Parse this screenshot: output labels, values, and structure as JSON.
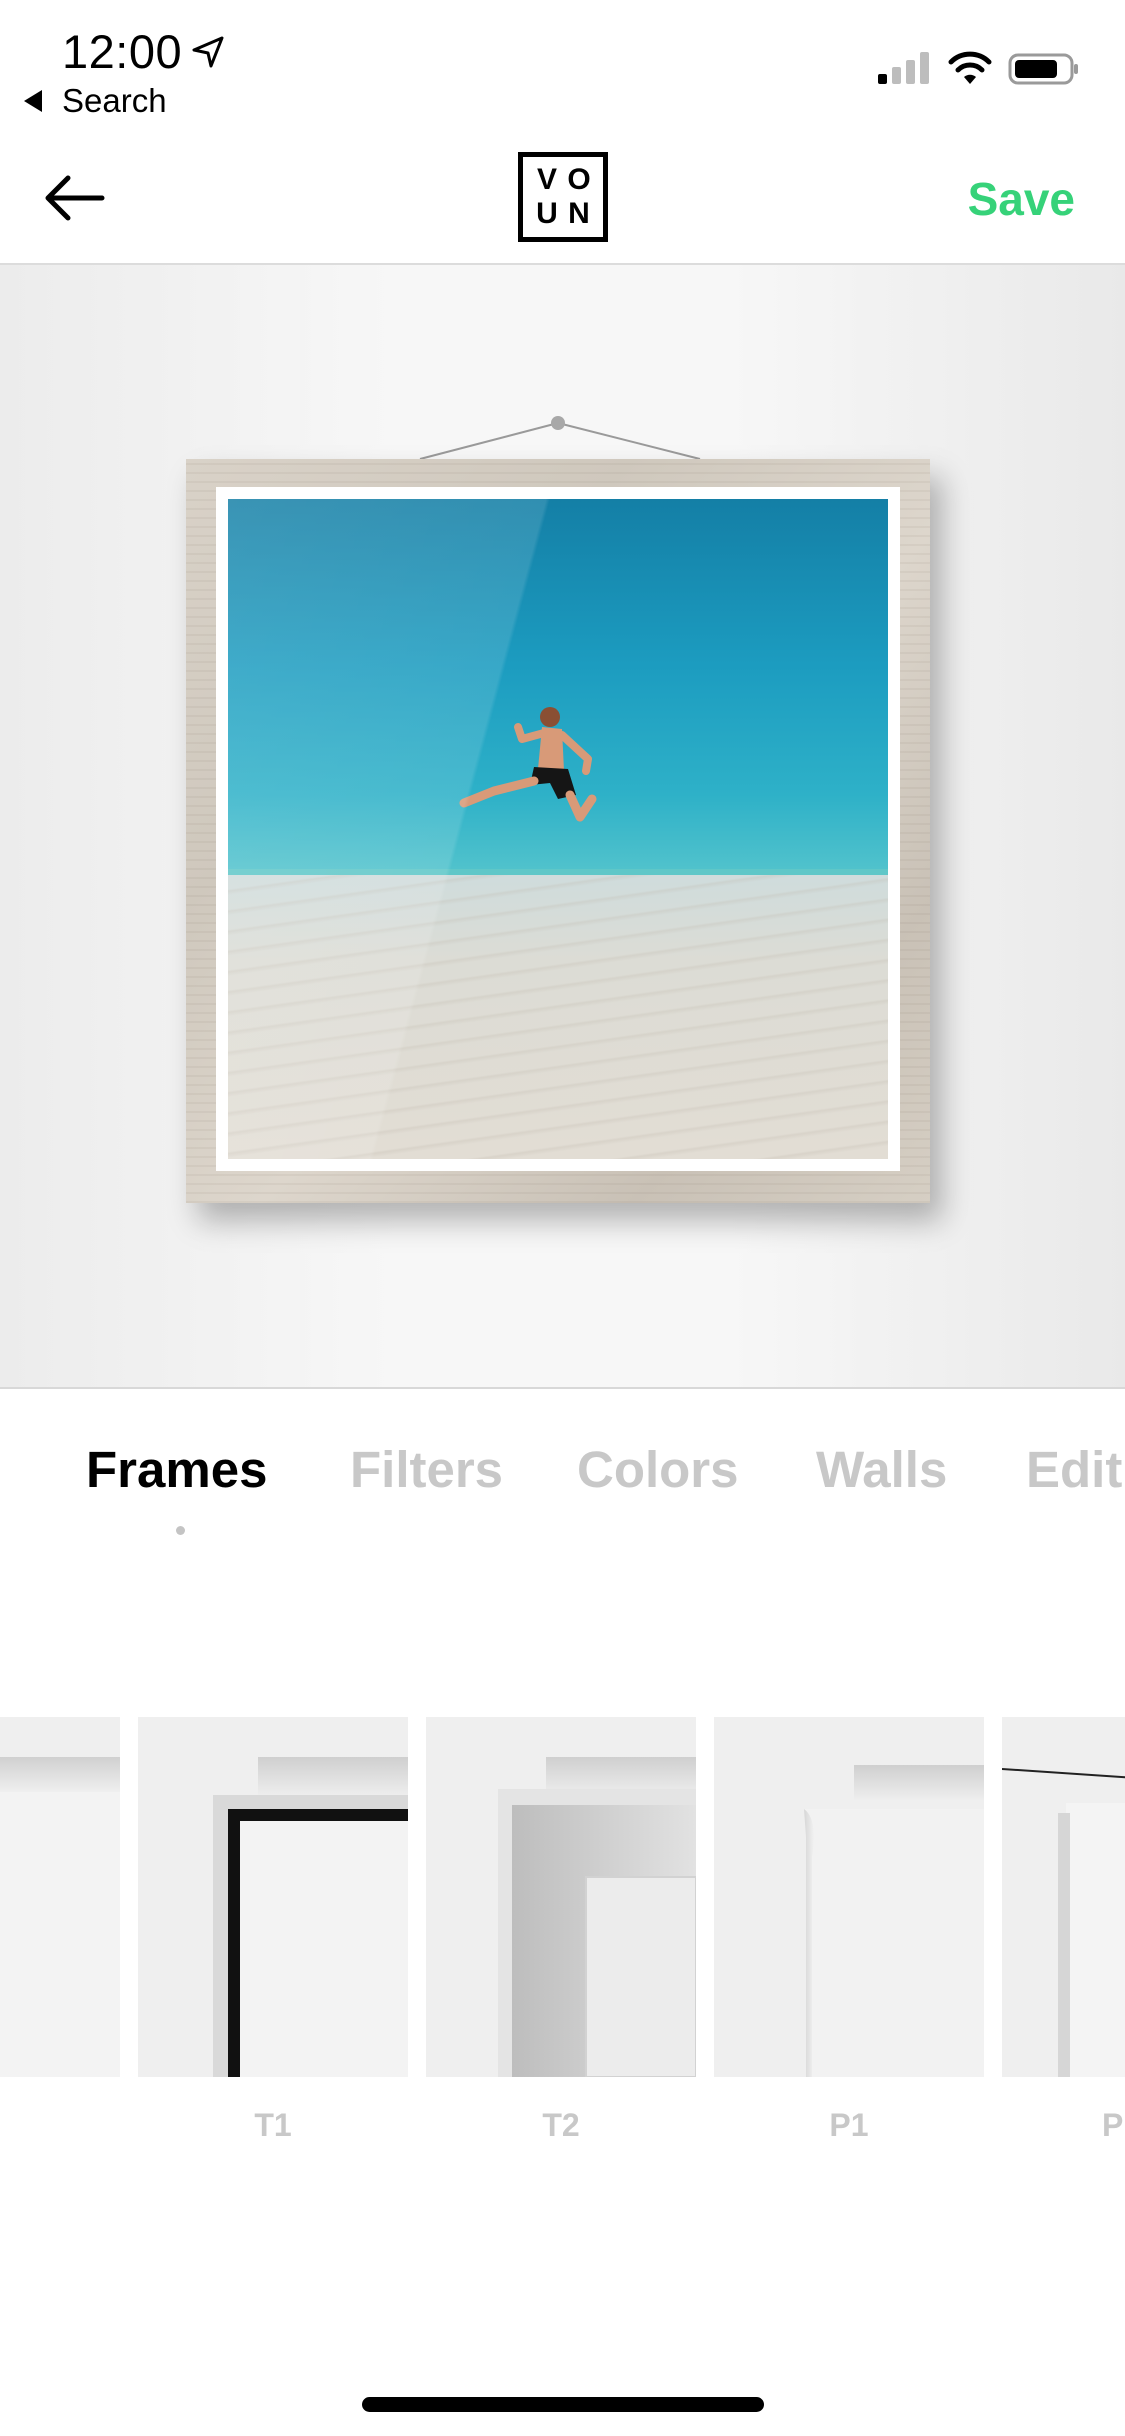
{
  "status_bar": {
    "time": "12:00",
    "back_app_label": "Search"
  },
  "nav": {
    "logo_letters": [
      "V",
      "O",
      "U",
      "N"
    ],
    "save_label": "Save"
  },
  "colors": {
    "accent": "#36d279",
    "tab_active": "#000000",
    "tab_inactive": "#c8c8c8"
  },
  "tabs": [
    {
      "label": "Frames",
      "active": true
    },
    {
      "label": "Filters",
      "active": false
    },
    {
      "label": "Colors",
      "active": false
    },
    {
      "label": "Walls",
      "active": false
    },
    {
      "label": "Edit",
      "active": false
    }
  ],
  "frames": [
    {
      "label": ""
    },
    {
      "label": "T1"
    },
    {
      "label": "T2"
    },
    {
      "label": "P1"
    },
    {
      "label": "P"
    }
  ],
  "icons": {
    "back": "arrow-left-icon",
    "location": "location-arrow-icon",
    "signal": "cellular-signal-icon",
    "wifi": "wifi-icon",
    "battery": "battery-icon"
  }
}
